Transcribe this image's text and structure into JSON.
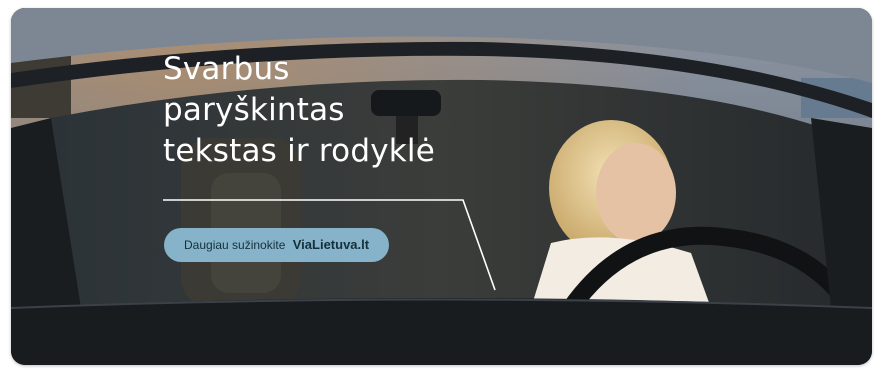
{
  "ad": {
    "headline_lines": [
      "Svarbus",
      "paryškintas",
      "tekstas ir rodyklė"
    ],
    "cta_label": "Daugiau sužinokite",
    "cta_brand": "ViaLietuva.lt"
  },
  "colors": {
    "cta_background": "#86b3c9",
    "headline_text": "#ffffff"
  }
}
